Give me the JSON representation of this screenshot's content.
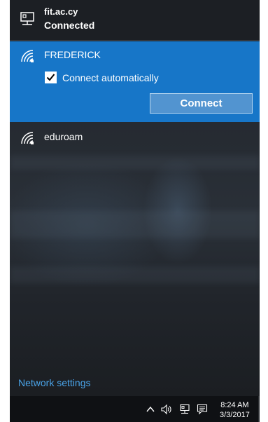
{
  "connected_network": {
    "ssid": "fit.ac.cy",
    "status": "Connected",
    "icon": "ethernet-icon"
  },
  "active_network": {
    "ssid": "FREDERICK",
    "icon": "wifi-icon",
    "auto_connect_label": "Connect automatically",
    "auto_connect_checked": true,
    "connect_label": "Connect"
  },
  "networks": [
    {
      "ssid": "eduroam",
      "icon": "wifi-icon"
    }
  ],
  "network_settings_label": "Network settings",
  "taskbar": {
    "tray_icons": [
      "chevron-up-icon",
      "volume-icon",
      "network-icon",
      "action-center-icon"
    ],
    "time": "8:24 AM",
    "date": "3/3/2017"
  },
  "colors": {
    "accent": "#1776c8",
    "button": "#5294d0",
    "link": "#4aa3e8",
    "panel": "#1f2329",
    "taskbar": "#0f1114"
  }
}
